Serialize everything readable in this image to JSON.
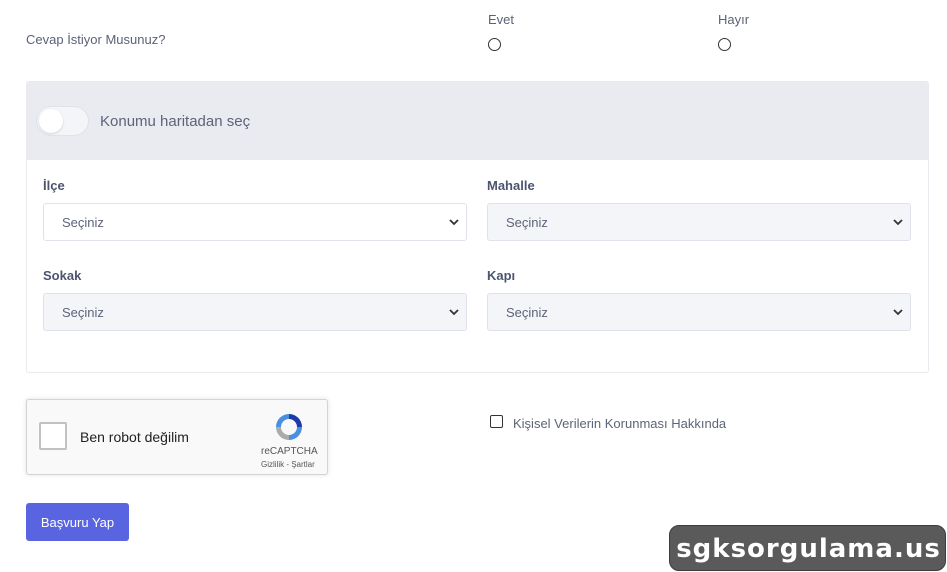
{
  "question": {
    "label": "Cevap İstiyor Musunuz?",
    "options": [
      {
        "label": "Evet",
        "selected": false
      },
      {
        "label": "Hayır",
        "selected": false
      }
    ]
  },
  "location": {
    "toggle_label": "Konumu haritadan seç",
    "toggle_on": false,
    "fields": {
      "ilce": {
        "label": "İlçe",
        "value": "Seçiniz"
      },
      "mahalle": {
        "label": "Mahalle",
        "value": "Seçiniz"
      },
      "sokak": {
        "label": "Sokak",
        "value": "Seçiniz"
      },
      "kapi": {
        "label": "Kapı",
        "value": "Seçiniz"
      }
    }
  },
  "recaptcha": {
    "label": "Ben robot değilim",
    "brand": "reCAPTCHA",
    "privacy": "Gizlilik",
    "separator": " - ",
    "terms": "Şartlar",
    "checked": false
  },
  "consent": {
    "label": "Kişisel Verilerin Korunması Hakkında",
    "checked": false
  },
  "submit": {
    "label": "Başvuru Yap"
  },
  "watermark": {
    "text": "sgksorgulama.us"
  },
  "colors": {
    "accent": "#5964e0",
    "panel_header": "#e9ebf0",
    "text": "#5e6479"
  }
}
